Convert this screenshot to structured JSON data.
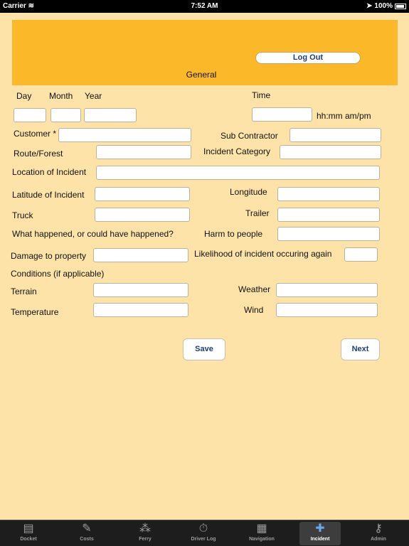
{
  "status_bar": {
    "carrier": "Carrier",
    "time": "7:52 AM",
    "battery": "100%"
  },
  "header": {
    "title": "General",
    "logout_label": "Log Out"
  },
  "form": {
    "date_labels": {
      "day": "Day",
      "month": "Month",
      "year": "Year"
    },
    "time_label": "Time",
    "time_hint": "hh:mm am/pm",
    "customer": "Customer *",
    "sub_contractor": "Sub Contractor",
    "route_forest": "Route/Forest",
    "incident_category": "Incident Category",
    "location": "Location of Incident",
    "latitude": "Latitude of Incident",
    "longitude": "Longitude",
    "truck": "Truck",
    "trailer": "Trailer",
    "what_happened": "What happened, or could have happened?",
    "harm": "Harm to people",
    "damage": "Damage to property",
    "likelihood": "Likelihood of incident occuring again",
    "conditions": "Conditions (if applicable)",
    "terrain": "Terrain",
    "weather": "Weather",
    "temperature": "Temperature",
    "wind": "Wind"
  },
  "buttons": {
    "save": "Save",
    "next": "Next"
  },
  "tabbar": {
    "tabs": [
      {
        "label": "Docket",
        "icon": "docket-icon"
      },
      {
        "label": "Costs",
        "icon": "costs-icon"
      },
      {
        "label": "Ferry",
        "icon": "ferry-icon"
      },
      {
        "label": "Driver Log",
        "icon": "stopwatch-icon"
      },
      {
        "label": "Navigation",
        "icon": "map-icon"
      },
      {
        "label": "Incident",
        "icon": "first-aid-icon",
        "active": true
      },
      {
        "label": "Admin",
        "icon": "key-icon"
      }
    ]
  },
  "colors": {
    "background": "#fde3a7",
    "banner": "#fbb929",
    "button_text": "#1e3e78",
    "tabbar": "#1d1d1d",
    "tab_active_icon": "#6aa6e8"
  }
}
